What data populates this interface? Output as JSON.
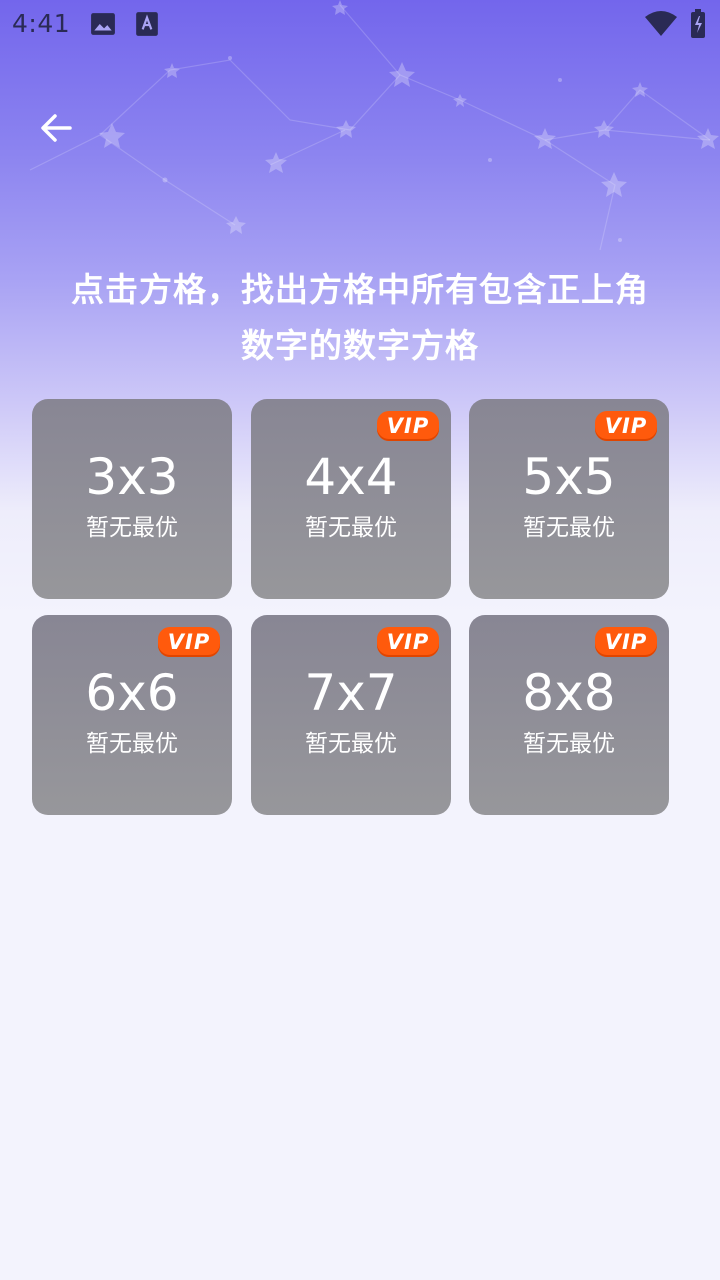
{
  "status_bar": {
    "time": "4:41",
    "icons": [
      "image-icon",
      "font-icon",
      "wifi-icon",
      "battery-icon"
    ]
  },
  "nav": {
    "back_icon": "arrow-left-icon"
  },
  "title": {
    "line1": "点击方格，找出方格中所有包含正上角",
    "line2": "数字的数字方格"
  },
  "colors": {
    "card": "#929199",
    "vip": "#ff5a0c",
    "gradient_top": "#7366ec",
    "background": "#f3f3fd"
  },
  "grid": {
    "items": [
      {
        "size": "3x3",
        "status": "暂无最优",
        "vip": false
      },
      {
        "size": "4x4",
        "status": "暂无最优",
        "vip": true,
        "badge": "VIP"
      },
      {
        "size": "5x5",
        "status": "暂无最优",
        "vip": true,
        "badge": "VIP"
      },
      {
        "size": "6x6",
        "status": "暂无最优",
        "vip": true,
        "badge": "VIP"
      },
      {
        "size": "7x7",
        "status": "暂无最优",
        "vip": true,
        "badge": "VIP"
      },
      {
        "size": "8x8",
        "status": "暂无最优",
        "vip": true,
        "badge": "VIP"
      }
    ]
  }
}
